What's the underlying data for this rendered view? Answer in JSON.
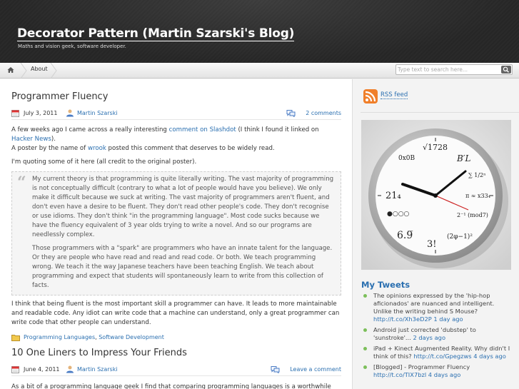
{
  "header": {
    "title": "Decorator Pattern (Martin Szarski's Blog)",
    "description": "Maths and vision geek, software developer."
  },
  "nav": {
    "about": "About",
    "search_placeholder": "Type text to search here..."
  },
  "posts": [
    {
      "title": "Programmer Fluency",
      "date": "July 3, 2011",
      "author": "Martin Szarski",
      "comments": "2 comments",
      "intro": {
        "t1": "A few weeks ago I came across a really interesting ",
        "link1": "comment on Slashdot",
        "t2": " (I think I found it linked on ",
        "link2": "Hacker News",
        "t3": ").",
        "t4": "A poster by the name of ",
        "link3": "wrook",
        "t5": " posted this comment that deserves to be widely read."
      },
      "quoting": "I'm quoting some of it here (all credit to the original poster).",
      "quote_p1": "My current theory is that programming is quite literally writing. The vast majority of programming is not conceptually difficult (contrary to what a lot of people would have you believe). We only make it difficult because we suck at writing. The vast majority of programmers aren't fluent, and don't even have a desire to be fluent. They don't read other people's code. They don't recognise or use idioms. They don't think \"in the programming language\". Most code sucks because we have the fluency equivalent of 3 year olds trying to write a novel. And so our programs are needlessly complex.",
      "quote_p2": "Those programmers with a \"spark\" are programmers who have an innate talent for the language. Or they are people who have read and read and read code. Or both. We teach programming wrong. We teach it the way Japanese teachers have been teaching English. We teach about programming and expect that students will spontaneously learn to write from this collection of facts.",
      "conclusion": "I think that being fluent is the most important skill a programmer can have. It leads to more maintainable and readable code. Any idiot can write code that a machine can understand, only a great programmer can write code that other people can understand.",
      "categories": [
        "Programming Languages",
        "Software Development"
      ],
      "category_sep": ", "
    },
    {
      "title": "10 One Liners to Impress Your Friends",
      "date": "June 4, 2011",
      "author": "Martin Szarski",
      "comments": "Leave a comment",
      "intro": "As a bit of a programming language geek I find that comparing programming languages is a worthwhile"
    }
  ],
  "sidebar": {
    "rss": "RSS feed",
    "tweets_title": "My Tweets",
    "tweets": [
      {
        "text": "The opinions expressed by the 'hip-hop aficionados' are nuanced and intelligent. Unlike the writing behind S Mouse? ",
        "link": "http://t.co/Xh3eD2P",
        "time": " 1 day ago"
      },
      {
        "text": "Android just corrected 'dubstep' to 'sunstroke'... ",
        "link": "",
        "time": "2 days ago"
      },
      {
        "text": "iPad + Kinect Augmented Reality. Why didn't I think of this? ",
        "link": "http://t.co/Gpegzws",
        "time": " 4 days ago"
      },
      {
        "text": "[Blogged] - Programmer Fluency ",
        "link": "http://t.co/TIX7bzl",
        "time": " 4 days ago"
      }
    ]
  },
  "clock": {
    "labels": [
      "0x0B",
      "√1728",
      "B′L",
      "∑ 1/2ⁿ",
      "21₄",
      "●○○○",
      "6.9̅",
      "3!",
      "(2φ−1)²",
      "2⁻¹ (mod7)",
      "π ≈ x33₄"
    ]
  },
  "colors": {
    "link": "#2a6fb0",
    "tweet_bullet": "#7cbf5a",
    "header_bg": "#272727"
  }
}
